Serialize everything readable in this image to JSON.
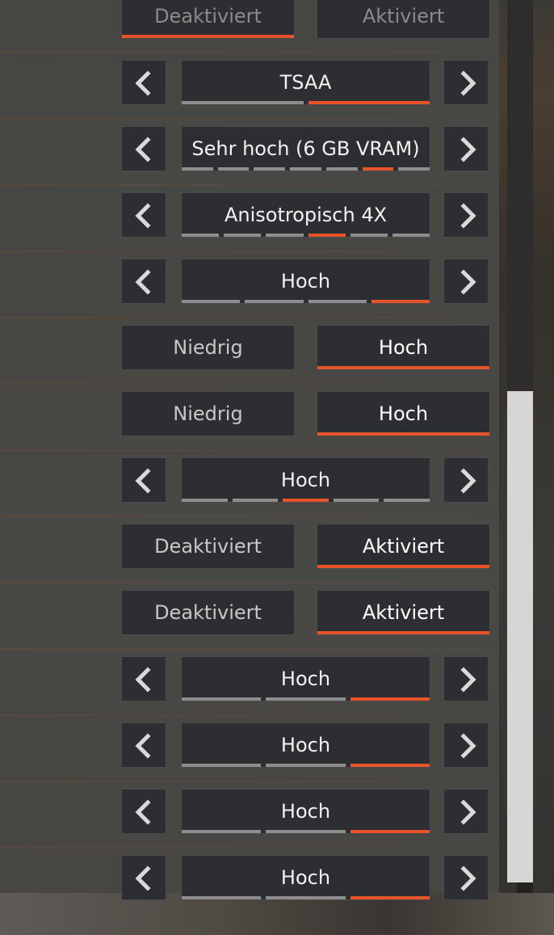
{
  "colors": {
    "accent": "#e8532a",
    "button_bg": "#2d2e31",
    "segment_inactive": "#8d8d8d",
    "scrollbar_thumb": "#d6d6d6"
  },
  "icons": {
    "left": "chevron-left-icon",
    "right": "chevron-right-icon"
  },
  "rows": [
    {
      "type": "toggle",
      "left": "Deaktiviert",
      "right": "Aktiviert",
      "selected": "left"
    },
    {
      "type": "selector",
      "value": "TSAA",
      "segments": 2,
      "active_index": 1
    },
    {
      "type": "selector",
      "value": "Sehr hoch (6 GB VRAM)",
      "segments": 7,
      "active_index": 5
    },
    {
      "type": "selector",
      "value": "Anisotropisch 4X",
      "segments": 6,
      "active_index": 3
    },
    {
      "type": "selector",
      "value": "Hoch",
      "segments": 4,
      "active_index": 3
    },
    {
      "type": "toggle",
      "left": "Niedrig",
      "right": "Hoch",
      "selected": "right"
    },
    {
      "type": "toggle",
      "left": "Niedrig",
      "right": "Hoch",
      "selected": "right"
    },
    {
      "type": "selector",
      "value": "Hoch",
      "segments": 5,
      "active_index": 2
    },
    {
      "type": "toggle",
      "left": "Deaktiviert",
      "right": "Aktiviert",
      "selected": "right"
    },
    {
      "type": "toggle",
      "left": "Deaktiviert",
      "right": "Aktiviert",
      "selected": "right"
    },
    {
      "type": "selector",
      "value": "Hoch",
      "segments": 3,
      "active_index": 2
    },
    {
      "type": "selector",
      "value": "Hoch",
      "segments": 3,
      "active_index": 2
    },
    {
      "type": "selector",
      "value": "Hoch",
      "segments": 3,
      "active_index": 2
    },
    {
      "type": "selector",
      "value": "Hoch",
      "segments": 3,
      "active_index": 2
    }
  ]
}
